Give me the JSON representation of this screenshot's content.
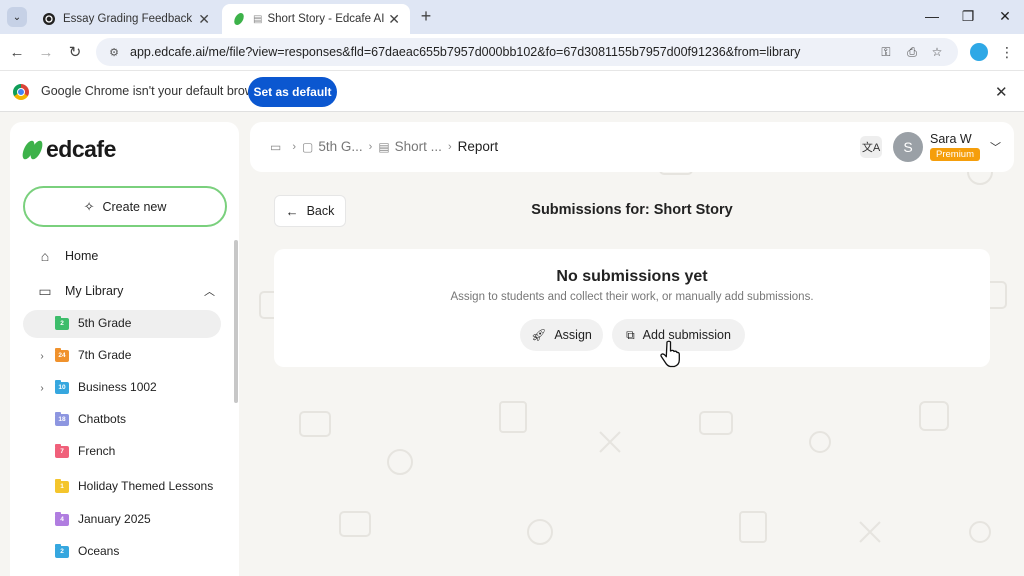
{
  "browser": {
    "tabs": [
      {
        "title": "Essay Grading Feedback",
        "active": false
      },
      {
        "title": "Short Story - Edcafe AI",
        "active": true
      }
    ],
    "url": "app.edcafe.ai/me/file?view=responses&fld=67daeac655b7957d000bb102&fo=67d3081155b7957d00f91236&from=library",
    "infobar": {
      "message": "Google Chrome isn't your default browser",
      "button": "Set as default"
    }
  },
  "app": {
    "logo_text": "edcafe",
    "create_new": "Create new",
    "nav": {
      "home": "Home",
      "library": "My Library"
    },
    "folders": [
      {
        "count": "2",
        "name": "5th Grade",
        "color": "#3dbd6b",
        "selected": true,
        "expandable": false
      },
      {
        "count": "24",
        "name": "7th Grade",
        "color": "#f0922d",
        "selected": false,
        "expandable": true
      },
      {
        "count": "10",
        "name": "Business 1002",
        "color": "#36a7df",
        "selected": false,
        "expandable": true
      },
      {
        "count": "18",
        "name": "Chatbots",
        "color": "#8d96e0",
        "selected": false,
        "expandable": false
      },
      {
        "count": "7",
        "name": "French",
        "color": "#f0607a",
        "selected": false,
        "expandable": false
      },
      {
        "count": "1",
        "name": "Holiday Themed Lessons",
        "color": "#f4c52c",
        "selected": false,
        "expandable": false
      },
      {
        "count": "4",
        "name": "January 2025",
        "color": "#b07de0",
        "selected": false,
        "expandable": false
      },
      {
        "count": "2",
        "name": "Oceans",
        "color": "#36a7df",
        "selected": false,
        "expandable": false
      }
    ],
    "breadcrumb": {
      "folder": "5th G...",
      "file": "Short ...",
      "current": "Report"
    },
    "user": {
      "initial": "S",
      "name": "Sara W",
      "plan": "Premium"
    },
    "main": {
      "back": "Back",
      "title": "Submissions for: Short Story",
      "empty_title": "No submissions yet",
      "empty_desc": "Assign to students and collect their work, or manually add submissions.",
      "assign": "Assign",
      "add_submission": "Add submission"
    }
  }
}
